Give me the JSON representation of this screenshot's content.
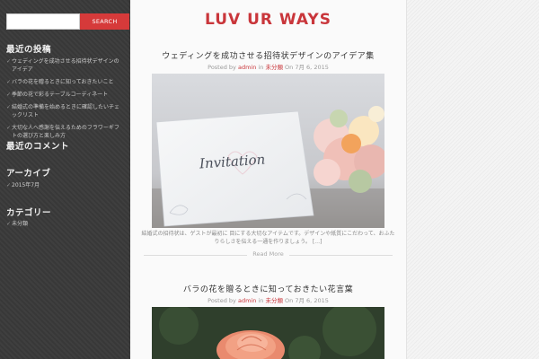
{
  "search": {
    "placeholder": "",
    "button": "SEARCH"
  },
  "sidebar": {
    "recent_posts": {
      "title": "最近の投稿",
      "items": [
        "ウェディングを成功させる招待状デザインのアイデア",
        "バラの花を贈るときに知っておきたいこと",
        "季節の花で彩るテーブルコーディネート",
        "結婚式の準備を始めるときに確認したいチェックリスト",
        "大切な人へ感謝を伝えるためのフラワーギフトの選び方と楽しみ方"
      ]
    },
    "recent_comments": {
      "title": "最近のコメント"
    },
    "archives": {
      "title": "アーカイブ",
      "items": [
        "2015年7月"
      ]
    },
    "categories": {
      "title": "カテゴリー",
      "items": [
        "未分類"
      ]
    }
  },
  "site": {
    "title": "LUV UR WAYS"
  },
  "posts": [
    {
      "title": "ウェディングを成功させる招待状デザインのアイデア集",
      "meta_posted": "Posted by",
      "meta_author": "admin",
      "meta_in": "in",
      "meta_category": "未分類",
      "meta_on": "On",
      "meta_date": "7月 6, 2015",
      "image_text": "Invitation",
      "excerpt": "結婚式の招待状は、ゲストが最初に 目にする大切なアイテムです。デザインや紙質にこだわって、おふたりらしさを伝える一通を作りましょう。 […]",
      "read_more": "Read More"
    },
    {
      "title": "バラの花を贈るときに知っておきたい花言葉",
      "meta_posted": "Posted by",
      "meta_author": "admin",
      "meta_in": "in",
      "meta_category": "未分類",
      "meta_on": "On",
      "meta_date": "7月 6, 2015"
    }
  ],
  "colors": {
    "accent": "#c9363b",
    "button": "#d63a3a",
    "sidebar_bg": "#3a3a3a"
  }
}
